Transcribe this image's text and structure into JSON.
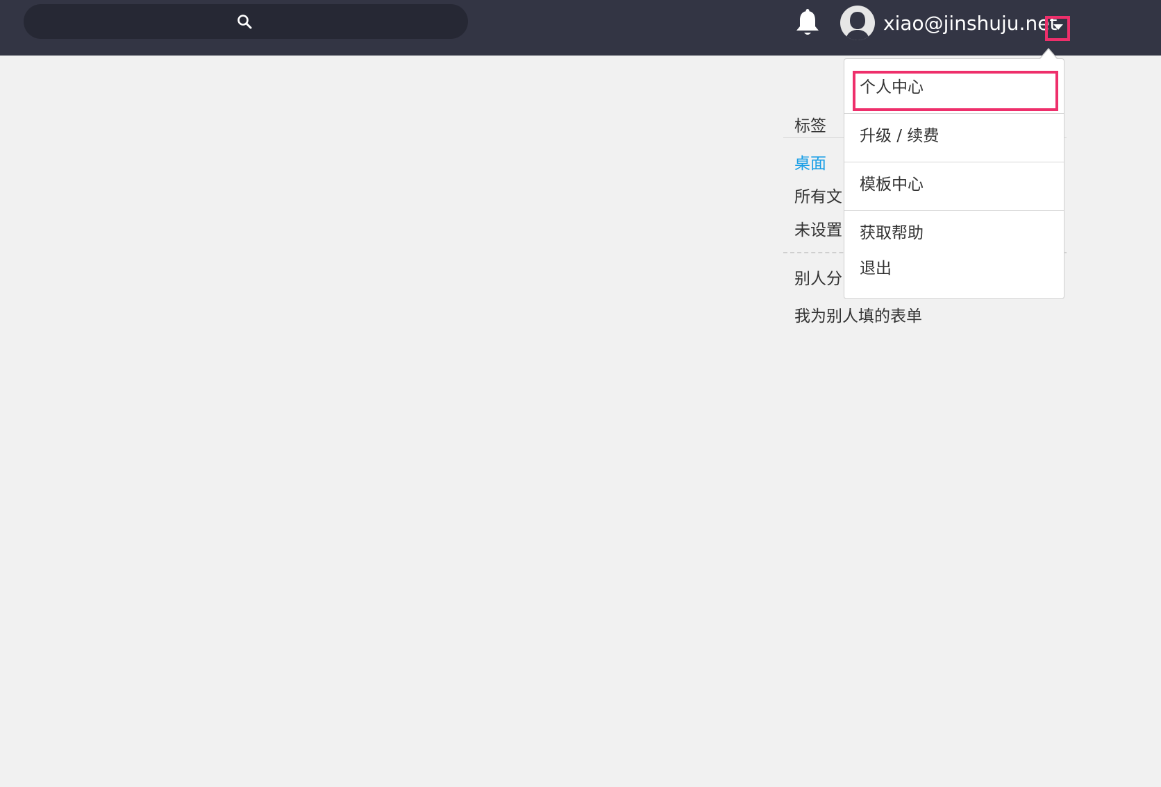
{
  "topbar": {
    "search_icon": "search-icon",
    "bell_icon": "bell-icon",
    "avatar_icon": "user-avatar-icon",
    "user_email": "xiao@jinshuju.net",
    "caret_icon": "caret-down-icon"
  },
  "sidebar": {
    "header": "标签",
    "items": [
      {
        "label": "桌面",
        "active": true
      },
      {
        "label": "所有文",
        "active": false
      },
      {
        "label": "未设置",
        "active": false
      },
      {
        "label": "别人分",
        "active": false
      },
      {
        "label": "我为别人填的表单",
        "active": false
      }
    ]
  },
  "user_menu": {
    "items": [
      {
        "label": "个人中心"
      },
      {
        "label": "升级 / 续费"
      },
      {
        "label": "模板中心"
      },
      {
        "label": "获取帮助"
      },
      {
        "label": "退出"
      }
    ]
  },
  "colors": {
    "topbar": "#333544",
    "search_bg": "#262834",
    "highlight": "#ee2f6b",
    "active_link": "#1a9fe6",
    "page_bg": "#f1f1f1"
  }
}
